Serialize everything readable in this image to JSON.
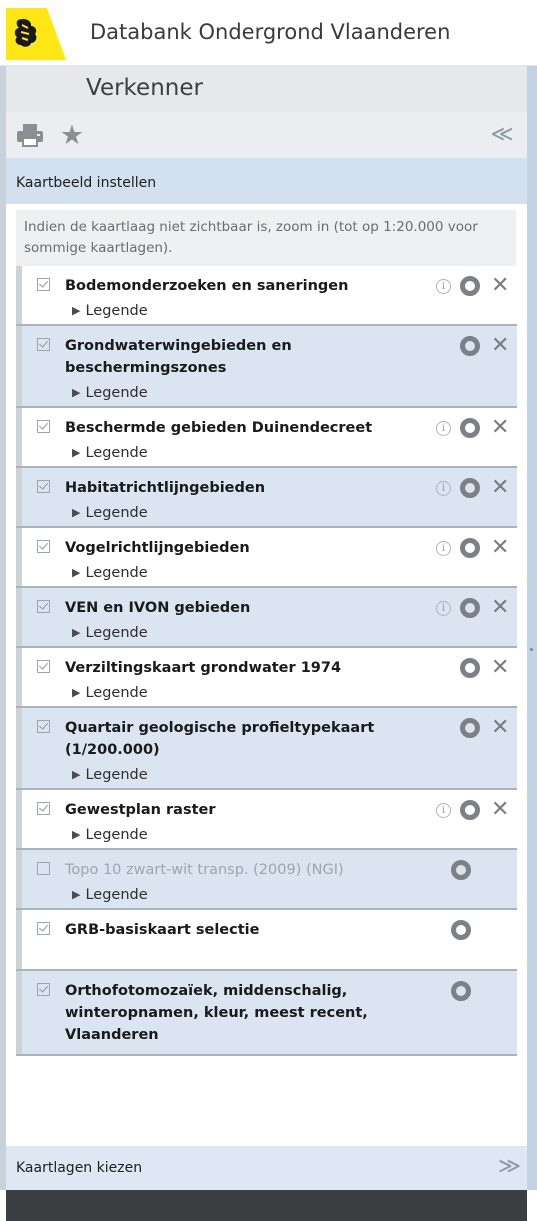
{
  "app": {
    "title": "Databank Ondergrond Vlaanderen"
  },
  "panel": {
    "title": "Verkenner"
  },
  "toolbar": {
    "print_icon": "printer-icon",
    "star_icon": "star-icon",
    "collapse_symbol": "≪"
  },
  "section": {
    "title": "Kaartbeeld instellen"
  },
  "notice": "Indien de kaartlaag niet zichtbaar is, zoom in (tot op 1:20.000 voor sommige kaartlagen).",
  "layers": [
    {
      "name": "Bodemonderzoeken en saneringen",
      "checked": true,
      "has_info": true,
      "has_delete": true,
      "legend": "Legende"
    },
    {
      "name": "Grondwaterwingebieden en beschermingszones",
      "checked": true,
      "has_info": false,
      "has_delete": true,
      "legend": "Legende"
    },
    {
      "name": "Beschermde gebieden Duinendecreet",
      "checked": true,
      "has_info": true,
      "has_delete": true,
      "legend": "Legende"
    },
    {
      "name": "Habitatrichtlijngebieden",
      "checked": true,
      "has_info": true,
      "has_delete": true,
      "legend": "Legende"
    },
    {
      "name": "Vogelrichtlijngebieden",
      "checked": true,
      "has_info": true,
      "has_delete": true,
      "legend": "Legende"
    },
    {
      "name": "VEN en IVON gebieden",
      "checked": true,
      "has_info": true,
      "has_delete": true,
      "legend": "Legende"
    },
    {
      "name": "Verziltingskaart grondwater 1974",
      "checked": true,
      "has_info": false,
      "has_delete": true,
      "legend": "Legende"
    },
    {
      "name": "Quartair geologische profieltypekaart (1/200.000)",
      "checked": true,
      "has_info": false,
      "has_delete": true,
      "legend": "Legende"
    },
    {
      "name": "Gewestplan raster",
      "checked": true,
      "has_info": true,
      "has_delete": true,
      "legend": "Legende"
    },
    {
      "name": "Topo 10 zwart-wit transp. (2009) (NGI)",
      "checked": false,
      "has_info": false,
      "has_delete": false,
      "legend": "Legende"
    },
    {
      "name": "GRB-basiskaart selectie",
      "checked": true,
      "has_info": false,
      "has_delete": false,
      "legend": ""
    },
    {
      "name": "Orthofotomozaïek, middenschalig, winteropnamen, kleur, meest recent, Vlaanderen",
      "checked": true,
      "has_info": false,
      "has_delete": false,
      "legend": ""
    }
  ],
  "bottom": {
    "title": "Kaartlagen kiezen",
    "expand_symbol": "≫"
  },
  "colors": {
    "logo_yellow": "#ffe615",
    "section_blue": "#d2e0ef",
    "row_blue": "#dae5f1",
    "footer_dark": "#3c3f42"
  }
}
